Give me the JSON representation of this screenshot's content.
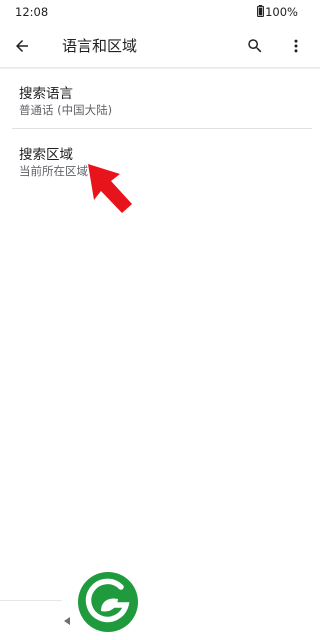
{
  "status_bar": {
    "time": "12:08",
    "battery": "100%"
  },
  "app_bar": {
    "title": "语言和区域",
    "icons": [
      "arrow-back-icon",
      "search-icon",
      "more-vert-icon"
    ]
  },
  "preferences": [
    {
      "title": "搜索语言",
      "summary": "普通话 (中国大陆)"
    },
    {
      "title": "搜索区域",
      "summary": "当前所在区域"
    }
  ],
  "colors": {
    "text_primary": "#202124",
    "text_secondary": "#5f6368",
    "annotation_arrow": "#e8141c",
    "logo_green": "#1f9a3c"
  }
}
